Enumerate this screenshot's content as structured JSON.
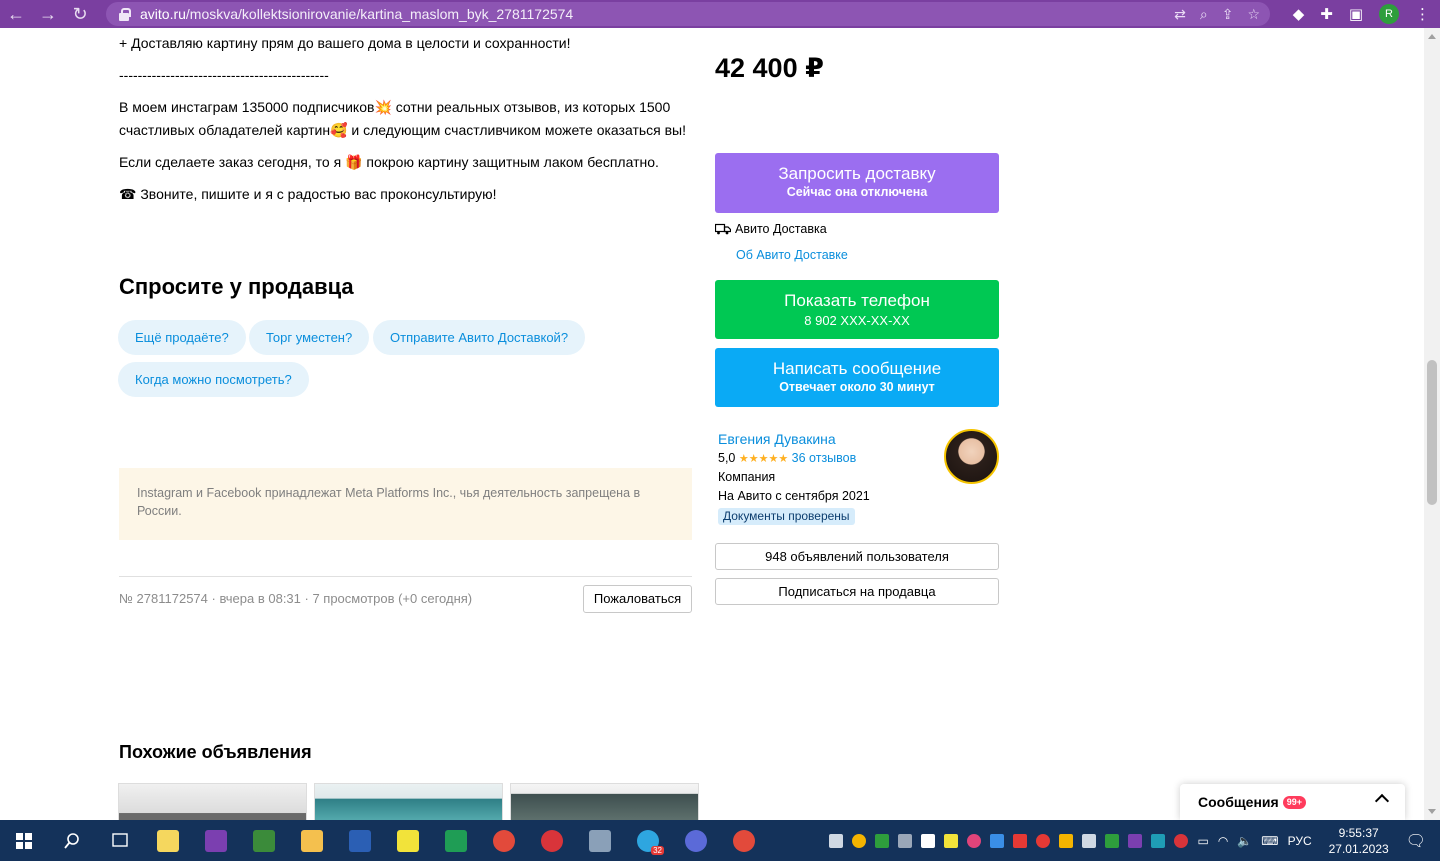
{
  "browser": {
    "url_host": "avito.ru",
    "url_path": "/moskva/kollektsionirovanie/kartina_maslom_byk_2781172574",
    "profile_initial": "R"
  },
  "description": {
    "p1": "+ Доставляю картину прям до вашего дома в целости и сохранности!",
    "p2": "---------------------------------------------",
    "p3a": "В моем инстаграм 135000 подписчиков",
    "p3b": " сотни реальных отзывов, из которых 1500 счастливых обладателей картин",
    "p3c": " и следующим счастливчиком можете оказаться вы!",
    "p4a": "Если сделаете заказ сегодня, то я ",
    "p4b": " покрою картину защитным лаком бесплатно.",
    "p5": "☎ Звоните, пишите и я с радостью вас проконсультирую!"
  },
  "ask": {
    "title": "Спросите у продавца",
    "chips": [
      "Ещё продаёте?",
      "Торг уместен?",
      "Отправите Авито Доставкой?",
      "Когда можно посмотреть?"
    ]
  },
  "notice": "Instagram и Facebook принадлежат Meta Platforms Inc., чья деятельность запрещена в России.",
  "meta": "№ 2781172574 · вчера в 08:31 · 7 просмотров (+0 сегодня)",
  "complain_label": "Пожаловаться",
  "similar_title": "Похожие объявления",
  "price": "42 400 ₽",
  "delivery_button": {
    "label": "Запросить доставку",
    "sub": "Сейчас она отключена"
  },
  "delivery_info": "Авито Доставка",
  "delivery_link": "Об Авито Доставке",
  "phone_button": {
    "label": "Показать телефон",
    "sub": "8 902 XXX-XX-XX"
  },
  "message_button": {
    "label": "Написать сообщение",
    "sub": "Отвечает около 30 минут"
  },
  "seller": {
    "name": "Евгения Дувакина",
    "rating": "5,0",
    "stars": "★★★★★",
    "reviews": "36 отзывов",
    "type": "Компания",
    "since": "На Авито с сентября 2021",
    "verified": "Документы проверены"
  },
  "ads_button": "948 объявлений пользователя",
  "subscribe_button": "Подписаться на продавца",
  "chat": {
    "label": "Сообщения",
    "badge": "99+"
  },
  "taskbar": {
    "lang": "РУС",
    "time": "9:55:37",
    "date": "27.01.2023",
    "telegram_badge": "32"
  },
  "colors": {
    "browser_bar": "#7a3fa0",
    "delivery": "#9b6ef0",
    "phone": "#00c853",
    "message": "#0aaaf5",
    "link": "#0a8edc",
    "taskbar": "#14325a"
  }
}
